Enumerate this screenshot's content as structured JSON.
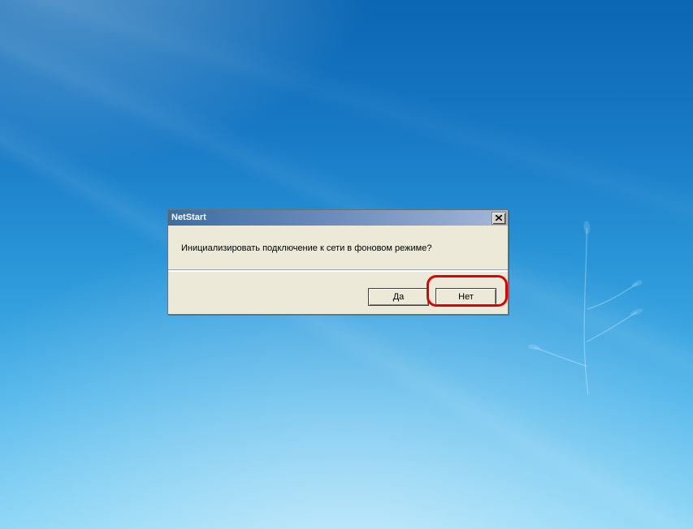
{
  "dialog": {
    "title": "NetStart",
    "message": "Инициализировать подключение к сети в фоновом режиме?",
    "buttons": {
      "yes": "Да",
      "no": "Нет"
    }
  }
}
